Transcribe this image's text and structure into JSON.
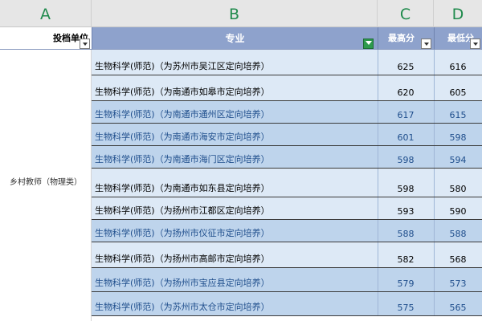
{
  "columns": {
    "a_letter": "A",
    "b_letter": "B",
    "c_letter": "C",
    "d_letter": "D"
  },
  "header": {
    "col_a": "投档单位",
    "col_b": "专业",
    "col_c": "最高分",
    "col_d": "最低分"
  },
  "category": "乡村教师（物理类）",
  "rows": [
    {
      "major": "生物科学(师范)（为苏州市吴江区定向培养）",
      "max": "625",
      "min": "616",
      "style": "light"
    },
    {
      "major": "生物科学(师范)（为南通市如皋市定向培养）",
      "max": "620",
      "min": "605",
      "style": "light"
    },
    {
      "major": "生物科学(师范)（为南通市通州区定向培养）",
      "max": "617",
      "min": "615",
      "style": "dark"
    },
    {
      "major": "生物科学(师范)（为南通市海安市定向培养）",
      "max": "601",
      "min": "598",
      "style": "dark"
    },
    {
      "major": "生物科学(师范)（为南通市海门区定向培养）",
      "max": "598",
      "min": "594",
      "style": "dark"
    },
    {
      "major": "生物科学(师范)（为南通市如东县定向培养）",
      "max": "598",
      "min": "580",
      "style": "light"
    },
    {
      "major": "生物科学(师范)（为扬州市江都区定向培养）",
      "max": "593",
      "min": "590",
      "style": "light"
    },
    {
      "major": "生物科学(师范)（为扬州市仪征市定向培养）",
      "max": "588",
      "min": "588",
      "style": "dark"
    },
    {
      "major": "生物科学(师范)（为扬州市高邮市定向培养）",
      "max": "582",
      "min": "568",
      "style": "light"
    },
    {
      "major": "生物科学(师范)（为扬州市宝应县定向培养）",
      "max": "579",
      "min": "573",
      "style": "dark"
    },
    {
      "major": "生物科学(师范)（为苏州市太仓市定向培养）",
      "max": "575",
      "min": "565",
      "style": "dark"
    }
  ]
}
